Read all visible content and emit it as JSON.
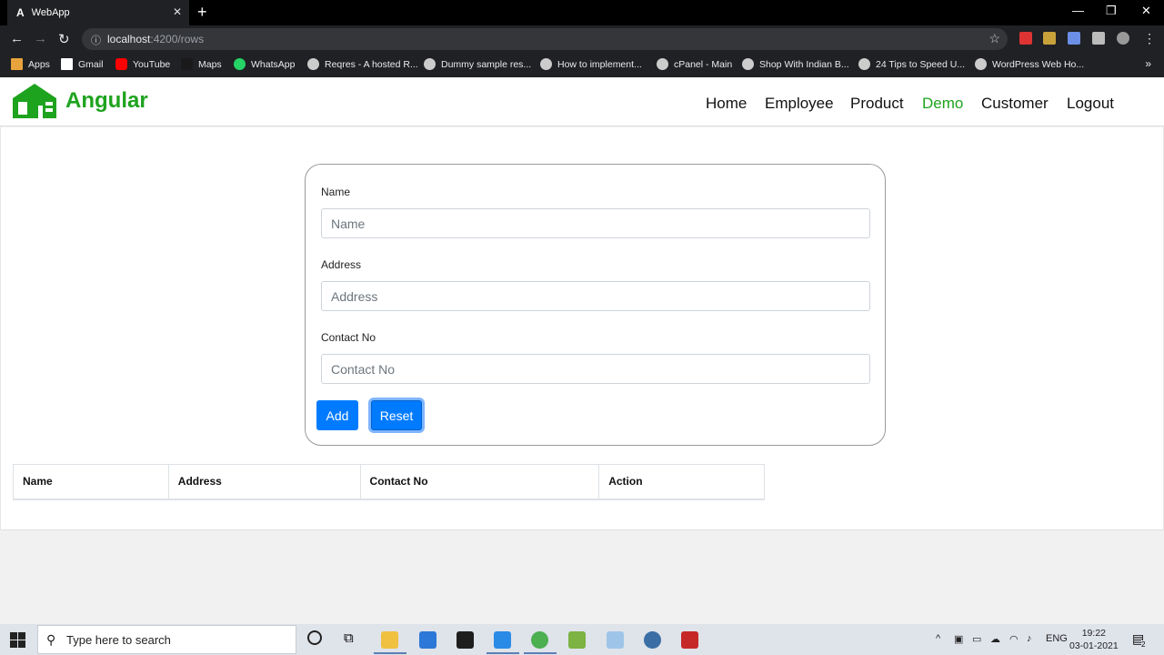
{
  "browser": {
    "tab_title": "WebApp",
    "tab_favicon": "A",
    "url_host": "localhost",
    "url_path": ":4200/rows",
    "bookmarks": [
      {
        "label": "Apps",
        "color": "#e8a33d"
      },
      {
        "label": "Gmail",
        "color": "#ffffff"
      },
      {
        "label": "YouTube",
        "color": "#ff0000"
      },
      {
        "label": "Maps",
        "color": "#1a1a1a"
      },
      {
        "label": "WhatsApp",
        "color": "#25d366"
      },
      {
        "label": "Reqres - A hosted R...",
        "color": "#cccccc"
      },
      {
        "label": "Dummy sample res...",
        "color": "#cccccc"
      },
      {
        "label": "How to implement...",
        "color": "#cccccc"
      },
      {
        "label": "cPanel - Main",
        "color": "#cccccc"
      },
      {
        "label": "Shop With Indian B...",
        "color": "#cccccc"
      },
      {
        "label": "24 Tips to Speed U...",
        "color": "#cccccc"
      },
      {
        "label": "WordPress Web Ho...",
        "color": "#cccccc"
      }
    ]
  },
  "app": {
    "brand": "Angular",
    "brand_color": "#1ea31e",
    "nav": [
      {
        "label": "Home",
        "active": false
      },
      {
        "label": "Employee",
        "active": false
      },
      {
        "label": "Product",
        "active": false
      },
      {
        "label": "Demo",
        "active": true
      },
      {
        "label": "Customer",
        "active": false
      },
      {
        "label": "Logout",
        "active": false
      }
    ]
  },
  "form": {
    "name_label": "Name",
    "name_placeholder": "Name",
    "address_label": "Address",
    "address_placeholder": "Address",
    "contact_label": "Contact No",
    "contact_placeholder": "Contact No",
    "add_label": "Add",
    "reset_label": "Reset",
    "button_color": "#007bff"
  },
  "table": {
    "headers": [
      "Name",
      "Address",
      "Contact No",
      "Action"
    ]
  },
  "taskbar": {
    "search_placeholder": "Type here to search",
    "language": "ENG",
    "time": "19:22",
    "date": "03-01-2021",
    "notification_count": "2"
  }
}
